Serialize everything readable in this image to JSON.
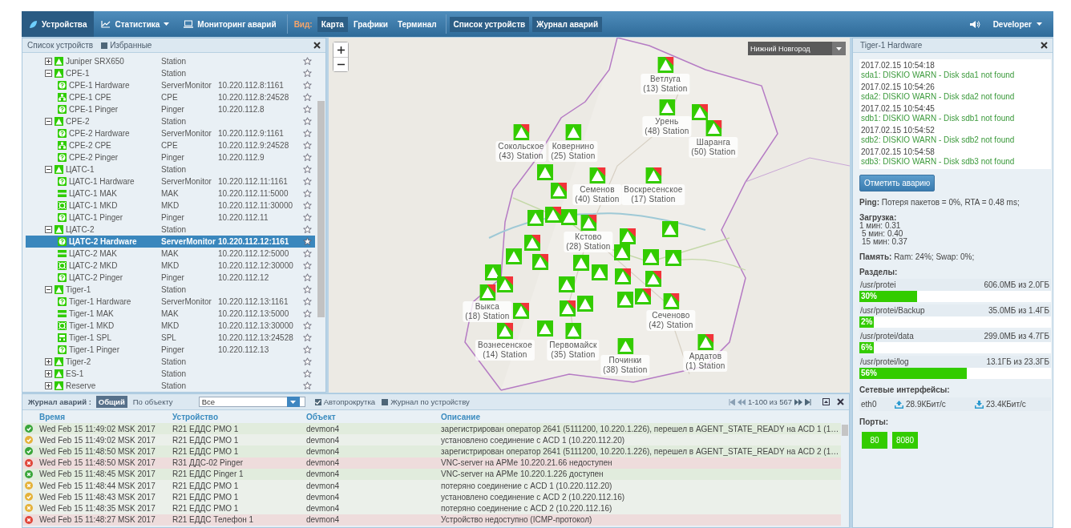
{
  "topbar": {
    "tabs": [
      {
        "label": "Устройства",
        "selected": true,
        "dropdown": false
      },
      {
        "label": "Статистика",
        "selected": false,
        "dropdown": true
      },
      {
        "label": "Мониторинг аварий",
        "selected": false,
        "dropdown": false
      }
    ],
    "view_label": "Вид:",
    "views": [
      {
        "label": "Карта",
        "selected": true
      },
      {
        "label": "Графики",
        "selected": false
      },
      {
        "label": "Терминал",
        "selected": false
      }
    ],
    "panels": [
      {
        "label": "Список устройств",
        "on": true
      },
      {
        "label": "Журнал аварий",
        "on": true
      }
    ],
    "user": "Developer"
  },
  "device_list": {
    "title": "Список устройств",
    "favorites": {
      "label": "Избранные",
      "checked": false
    },
    "items": [
      {
        "name": "Juniper SRX650",
        "kind": "station",
        "type": "Station",
        "expanded": false,
        "selected": false
      },
      {
        "name": "CPE-1",
        "kind": "station",
        "type": "Station",
        "expanded": true,
        "selected": false,
        "children": [
          {
            "name": "CPE-1 Hardware",
            "kind": "hardware",
            "type": "ServerMonitor",
            "address": "10.220.112.8:1161",
            "selected": false
          },
          {
            "name": "CPE-1 CPE",
            "kind": "cpe",
            "type": "CPE",
            "address": "10.220.112.8:24528",
            "selected": false
          },
          {
            "name": "CPE-1 Pinger",
            "kind": "hardware",
            "type": "Pinger",
            "address": "10.220.112.8",
            "selected": false
          }
        ]
      },
      {
        "name": "CPE-2",
        "kind": "station",
        "type": "Station",
        "expanded": true,
        "selected": false,
        "children": [
          {
            "name": "CPE-2 Hardware",
            "kind": "hardware",
            "type": "ServerMonitor",
            "address": "10.220.112.9:1161",
            "selected": false
          },
          {
            "name": "CPE-2 CPE",
            "kind": "cpe",
            "type": "CPE",
            "address": "10.220.112.9:24528",
            "selected": false
          },
          {
            "name": "CPE-2 Pinger",
            "kind": "hardware",
            "type": "Pinger",
            "address": "10.220.112.9",
            "selected": false
          }
        ]
      },
      {
        "name": "ЦАТС-1",
        "kind": "station",
        "type": "Station",
        "expanded": true,
        "selected": false,
        "children": [
          {
            "name": "ЦАТС-1 Hardware",
            "kind": "hardware",
            "type": "ServerMonitor",
            "address": "10.220.112.11:1161",
            "selected": false
          },
          {
            "name": "ЦАТС-1 MAK",
            "kind": "mak",
            "type": "MAK",
            "address": "10.220.112.11:5000",
            "selected": false
          },
          {
            "name": "ЦАТС-1 MKD",
            "kind": "mkd",
            "type": "MKD",
            "address": "10.220.112.11:30000",
            "selected": false
          },
          {
            "name": "ЦАТС-1 Pinger",
            "kind": "hardware",
            "type": "Pinger",
            "address": "10.220.112.11",
            "selected": false
          }
        ]
      },
      {
        "name": "ЦАТС-2",
        "kind": "station",
        "type": "Station",
        "expanded": true,
        "selected": false,
        "children": [
          {
            "name": "ЦАТС-2 Hardware",
            "kind": "hardware",
            "type": "ServerMonitor",
            "address": "10.220.112.12:1161",
            "selected": true
          },
          {
            "name": "ЦАТС-2 MAK",
            "kind": "mak",
            "type": "MAK",
            "address": "10.220.112.12:5000",
            "selected": false
          },
          {
            "name": "ЦАТС-2 MKD",
            "kind": "mkd",
            "type": "MKD",
            "address": "10.220.112.12:30000",
            "selected": false
          },
          {
            "name": "ЦАТС-2 Pinger",
            "kind": "hardware",
            "type": "Pinger",
            "address": "10.220.112.12",
            "selected": false
          }
        ]
      },
      {
        "name": "Tiger-1",
        "kind": "station",
        "type": "Station",
        "expanded": true,
        "selected": false,
        "children": [
          {
            "name": "Tiger-1 Hardware",
            "kind": "hardware",
            "type": "ServerMonitor",
            "address": "10.220.112.13:1161",
            "selected": false
          },
          {
            "name": "Tiger-1 MAK",
            "kind": "mak",
            "type": "MAK",
            "address": "10.220.112.13:5000",
            "selected": false
          },
          {
            "name": "Tiger-1 MKD",
            "kind": "mkd",
            "type": "MKD",
            "address": "10.220.112.13:30000",
            "selected": false
          },
          {
            "name": "Tiger-1 SPL",
            "kind": "spl",
            "type": "SPL",
            "address": "10.220.112.13:24528",
            "selected": false
          },
          {
            "name": "Tiger-1 Pinger",
            "kind": "hardware",
            "type": "Pinger",
            "address": "10.220.112.13",
            "selected": false
          }
        ]
      },
      {
        "name": "Tiger-2",
        "kind": "station",
        "type": "Station",
        "expanded": false,
        "selected": false
      },
      {
        "name": "ES-1",
        "kind": "station",
        "type": "Station",
        "expanded": false,
        "selected": false
      },
      {
        "name": "Reserve",
        "kind": "station",
        "type": "Station",
        "expanded": false,
        "selected": false
      }
    ]
  },
  "map": {
    "region": "Нижний Новгород",
    "markers": [
      {
        "name": "Ветлуга",
        "count": "(13)",
        "type": "Station",
        "alarm": true
      },
      {
        "name": "Урень",
        "count": "(48)",
        "type": "Station",
        "alarm": false
      },
      {
        "name": "Шаранга",
        "count": "(50)",
        "type": "Station",
        "alarm": true
      },
      {
        "name": "Сокольское",
        "count": "(43)",
        "type": "Station",
        "alarm": true
      },
      {
        "name": "Ковернино",
        "count": "(25)",
        "type": "Station",
        "alarm": false
      },
      {
        "name": "Семенов",
        "count": "(40)",
        "type": "Station",
        "alarm": true
      },
      {
        "name": "Воскресенское",
        "count": "(17)",
        "type": "Station",
        "alarm": true
      },
      {
        "name": "Кстово",
        "count": "(28)",
        "type": "Station",
        "alarm": true
      },
      {
        "name": "Выкса",
        "count": "(18)",
        "type": "Station",
        "alarm": true
      },
      {
        "name": "Сеченово",
        "count": "(42)",
        "type": "Station",
        "alarm": true
      },
      {
        "name": "Вознесенское",
        "count": "(14)",
        "type": "Station",
        "alarm": true
      },
      {
        "name": "Первомайск",
        "count": "(35)",
        "type": "Station",
        "alarm": false
      },
      {
        "name": "Ардатов",
        "count": "(1)",
        "type": "Station",
        "alarm": true
      },
      {
        "name": "Починки",
        "count": "(38)",
        "type": "Station",
        "alarm": false
      },
      {
        "alarm": false
      },
      {
        "alarm": true
      },
      {
        "alarm": false
      },
      {
        "alarm": true
      },
      {
        "alarm": false
      },
      {
        "alarm": true
      },
      {
        "alarm": false
      },
      {
        "alarm": true
      },
      {
        "alarm": false
      },
      {
        "alarm": false
      },
      {
        "alarm": false
      },
      {
        "alarm": true
      },
      {
        "alarm": false
      },
      {
        "alarm": true
      },
      {
        "alarm": false
      },
      {
        "alarm": false
      },
      {
        "alarm": true
      },
      {
        "alarm": true
      },
      {
        "alarm": false
      },
      {
        "alarm": false
      },
      {
        "alarm": true
      },
      {
        "alarm": false
      },
      {
        "alarm": true
      },
      {
        "alarm": false
      },
      {
        "alarm": true
      },
      {
        "alarm": false
      },
      {
        "alarm": true
      }
    ]
  },
  "details": {
    "title": "Tiger-1 Hardware",
    "events": [
      {
        "time": "2017.02.15 10:54:18",
        "message": "sda1: DISKIO WARN - Disk sda1 not found"
      },
      {
        "time": "2017.02.15 10:54:26",
        "message": "sda2: DISKIO WARN - Disk sda2 not found"
      },
      {
        "time": "2017.02.15 10:54:45",
        "message": "sdb1: DISKIO WARN - Disk sdb1 not found"
      },
      {
        "time": "2017.02.15 10:54:52",
        "message": "sdb2: DISKIO WARN - Disk sdb2 not found"
      },
      {
        "time": "2017.02.15 10:54:58",
        "message": "sdb3: DISKIO WARN - Disk sdb3 not found"
      }
    ],
    "mark_button": "Отметить аварию",
    "ping": "**Ping:** Потеря пакетов = 0%, RTA = 0.48 ms;",
    "load": {
      "label": "Загрузка:",
      "lines": [
        "1 мин: 0.31",
        "5 мин: 0.40",
        "15 мин: 0.37"
      ]
    },
    "memory": "**Память:** Ram: 24%; Swap: 0%;",
    "partitions": {
      "label": "Разделы:",
      "items": [
        {
          "path": "/usr/protei",
          "usage": "606.0МБ из 2.0ГБ",
          "level": 0.3,
          "percent": "30%"
        },
        {
          "path": "/usr/protei/Backup",
          "usage": "35.0МБ из 1.4ГБ",
          "level": 0.02,
          "percent": "2%"
        },
        {
          "path": "/usr/protei/data",
          "usage": "299.0МБ из 4.7ГБ",
          "level": 0.06,
          "percent": "6%"
        },
        {
          "path": "/usr/protei/log",
          "usage": "13.1ГБ из 23.3ГБ",
          "level": 0.56,
          "percent": "56%"
        }
      ]
    },
    "network": {
      "label": "Сетевые интерфейсы:",
      "interfaces": [
        {
          "name": "eth0",
          "up": "28.9КБит/с",
          "down": "23.4КБит/с"
        }
      ]
    },
    "ports": {
      "label": "Порты:",
      "items": [
        "80",
        "8080"
      ]
    }
  },
  "alarm_log": {
    "title": "Журнал аварий :",
    "modes": [
      {
        "label": "Общий",
        "selected": true
      },
      {
        "label": "По объекту",
        "selected": false
      }
    ],
    "filter": "Все",
    "autoscroll": {
      "label": "Автопрокрутка",
      "checked": true
    },
    "device_log": {
      "label": "Журнал по устройству",
      "checked": false
    },
    "pager": "1-100 из 567",
    "columns": [
      "Время",
      "Устройство",
      "Объект",
      "Описание"
    ],
    "rows": [
      {
        "kind": "ok",
        "time": "Wed Feb 15 11:49:02 MSK 2017",
        "device": "R21 ЕДДС РМО 1",
        "object": "devmon4",
        "description": "зарегистрирован оператор 2641 (5111200, 10.220.1.226), перешел в AGENT_STATE_READY на ACD 1 (1…"
      },
      {
        "kind": "connected",
        "time": "Wed Feb 15 11:49:02 MSK 2017",
        "device": "R21 ЕДДС РМО 1",
        "object": "devmon4",
        "description": "установлено соединение с ACD 1 (10.220.112.20)"
      },
      {
        "kind": "ok",
        "time": "Wed Feb 15 11:48:50 MSK 2017",
        "device": "R21 ЕДДС РМО 1",
        "object": "devmon4",
        "description": "зарегистрирован оператор 2641 (5111200, 10.220.1.226), перешел в AGENT_STATE_READY на ACD 2 (1…"
      },
      {
        "kind": "failed",
        "time": "Wed Feb 15 11:48:50 MSK 2017",
        "device": "R31 ДДС-02 Pinger",
        "object": "devmon4",
        "description": "VNC-server на АРМе 10.220.21.66 недоступен"
      },
      {
        "kind": "recovered",
        "time": "Wed Feb 15 11:48:45 MSK 2017",
        "device": "R21 ЕДДС Pinger 1",
        "object": "devmon4",
        "description": "VNC-server на АРМе 10.220.1.226 доступен"
      },
      {
        "kind": "disconnected",
        "time": "Wed Feb 15 11:48:44 MSK 2017",
        "device": "R21 ЕДДС РМО 1",
        "object": "devmon4",
        "description": "потеряно соединение с ACD 1 (10.220.112.20)"
      },
      {
        "kind": "connected",
        "time": "Wed Feb 15 11:48:43 MSK 2017",
        "device": "R21 ЕДДС РМО 1",
        "object": "devmon4",
        "description": "установлено соединение с ACD 2 (10.220.112.16)"
      },
      {
        "kind": "disconnected",
        "time": "Wed Feb 15 11:48:35 MSK 2017",
        "device": "R21 ЕДДС РМО 1",
        "object": "devmon4",
        "description": "потеряно соединение с ACD 2 (10.220.112.16)"
      },
      {
        "kind": "failed",
        "time": "Wed Feb 15 11:48:27 MSK 2017",
        "device": "R21 ЕДДС Телефон 1",
        "object": "devmon4",
        "description": "Устройство недоступно (ICMP-протокол)"
      }
    ]
  }
}
